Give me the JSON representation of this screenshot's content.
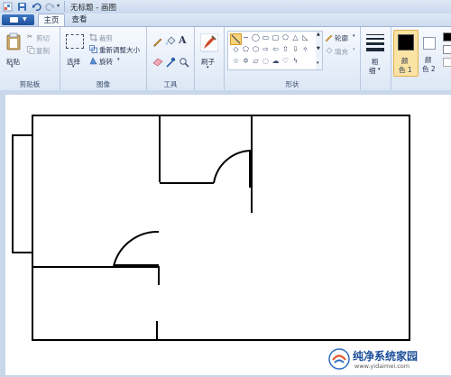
{
  "window": {
    "title": "无标题 - 画图"
  },
  "quick_access": {
    "icons": [
      "save-icon",
      "undo-icon",
      "redo-icon",
      "customize-icon"
    ]
  },
  "menu": {
    "tabs": [
      {
        "label": "主页",
        "active": true
      },
      {
        "label": "查看",
        "active": false
      }
    ]
  },
  "ribbon": {
    "clipboard": {
      "paste_label": "粘贴",
      "cut_label": "剪切",
      "copy_label": "复制",
      "group_label": "剪贴板"
    },
    "image": {
      "select_label": "选择",
      "crop_label": "裁剪",
      "resize_label": "重新调整大小",
      "rotate_label": "旋转",
      "group_label": "图像"
    },
    "tools": {
      "group_label": "工具"
    },
    "brushes": {
      "label": "刷子"
    },
    "shapes": {
      "outline_label": "轮廓",
      "fill_label": "填充",
      "group_label": "形状"
    },
    "size": {
      "label_line1": "粗",
      "label_line2": "细"
    },
    "colors": {
      "color1_line1": "颜",
      "color1_line2": "色 1",
      "color2_line1": "颜",
      "color2_line2": "色 2",
      "color1_value": "#000000",
      "color2_value": "#ffffff",
      "accent": "#f5c25a"
    }
  },
  "watermark": {
    "title": "纯净系统家园",
    "url": "www.yidaimei.com"
  }
}
